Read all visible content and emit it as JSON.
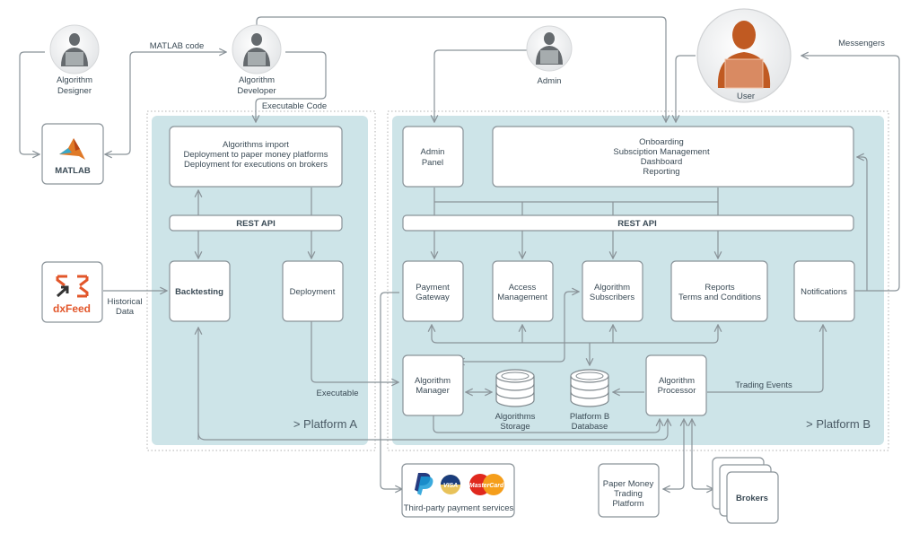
{
  "actors": {
    "algorithm_designer": "Algorithm\nDesigner",
    "algorithm_developer": "Algorithm\nDeveloper",
    "admin": "Admin",
    "user": "User"
  },
  "edge_labels": {
    "matlab_code": "MATLAB code",
    "executable_code": "Executable Code",
    "historical_data": "Historical\nData",
    "executable": "Executable",
    "trading_events": "Trading Events",
    "messengers": "Messengers"
  },
  "external": {
    "matlab": "MATLAB",
    "dxfeed": "dxFeed",
    "payment_services": "Third-party payment services",
    "paypal": "P",
    "visa": "VISA",
    "mastercard": "MasterCard",
    "paper_money": "Paper Money\nTrading\nPlatform",
    "brokers": "Brokers"
  },
  "platform_a": {
    "label": "> Platform A",
    "import_box": "Algorithms import\nDeployment to paper money platforms\nDeployment for executions on brokers",
    "rest_api": "REST API",
    "backtesting": "Backtesting",
    "deployment": "Deployment"
  },
  "platform_b": {
    "label": "> Platform B",
    "admin_panel": "Admin\nPanel",
    "onboarding_box": "Onboarding\nSubsciption Management\nDashboard\nReporting",
    "rest_api": "REST API",
    "payment_gateway": "Payment\nGateway",
    "access_management": "Access\nManagement",
    "algorithm_subscribers": "Algorithm\nSubscribers",
    "reports": "Reports\nTerms and Conditions",
    "notifications": "Notifications",
    "algorithm_manager": "Algorithm\nManager",
    "algorithms_storage": "Algorithms\nStorage",
    "platform_b_database": "Platform B\nDatabase",
    "algorithm_processor": "Algorithm\nProcessor"
  },
  "colors": {
    "panel": "#cde4e8",
    "accent_orange": "#c05a22",
    "line": "#8a9399",
    "text": "#3a4a55"
  }
}
